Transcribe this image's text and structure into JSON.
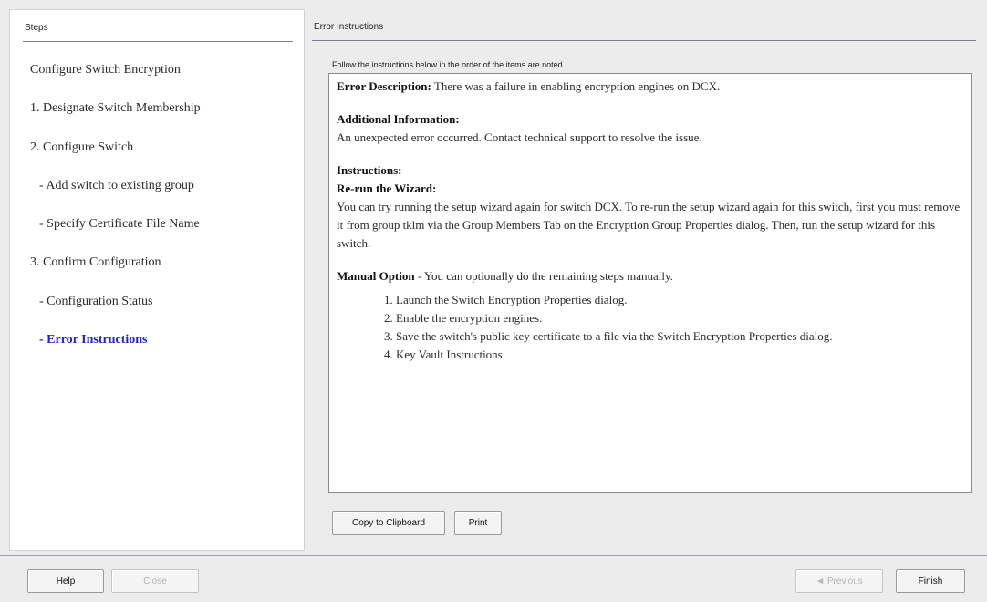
{
  "steps_panel": {
    "header": "Steps",
    "items": [
      {
        "label": "Configure Switch Encryption",
        "level": "top",
        "active": false
      },
      {
        "label": "1. Designate Switch Membership",
        "level": "top",
        "active": false
      },
      {
        "label": "2. Configure Switch",
        "level": "top",
        "active": false
      },
      {
        "label": "- Add switch to existing group",
        "level": "sub",
        "active": false
      },
      {
        "label": "- Specify Certificate File Name",
        "level": "sub",
        "active": false
      },
      {
        "label": "3. Confirm Configuration",
        "level": "top",
        "active": false
      },
      {
        "label": "- Configuration Status",
        "level": "sub",
        "active": false
      },
      {
        "label": "- Error Instructions",
        "level": "sub",
        "active": true
      }
    ]
  },
  "content_panel": {
    "header": "Error Instructions",
    "intro": "Follow the instructions below in the order of the items are noted.",
    "error_description_label": "Error Description:",
    "error_description_text": "There was a failure in enabling encryption engines on DCX.",
    "additional_info_label": "Additional Information:",
    "additional_info_text": "An unexpected error occurred. Contact technical support to resolve the issue.",
    "instructions_label": "Instructions:",
    "rerun_label": "Re-run the Wizard:",
    "rerun_text": "You can try running the setup wizard again for switch DCX. To re-run the setup wizard again for this switch, first you must remove it from group tklm via the Group Members Tab on the Encryption Group Properties dialog. Then, run the setup wizard for this switch.",
    "manual_label": "Manual Option",
    "manual_text": " - You can optionally do the remaining steps manually.",
    "manual_steps": [
      "1. Launch the Switch Encryption Properties dialog.",
      "2. Enable the encryption engines.",
      "3. Save the switch's public key certificate to a file via the Switch Encryption Properties dialog.",
      "4. Key Vault Instructions"
    ],
    "copy_button": "Copy to Clipboard",
    "print_button": "Print"
  },
  "footer": {
    "help_button": "Help",
    "close_button": "Close",
    "previous_button": "◄ Previous",
    "finish_button": "Finish"
  }
}
